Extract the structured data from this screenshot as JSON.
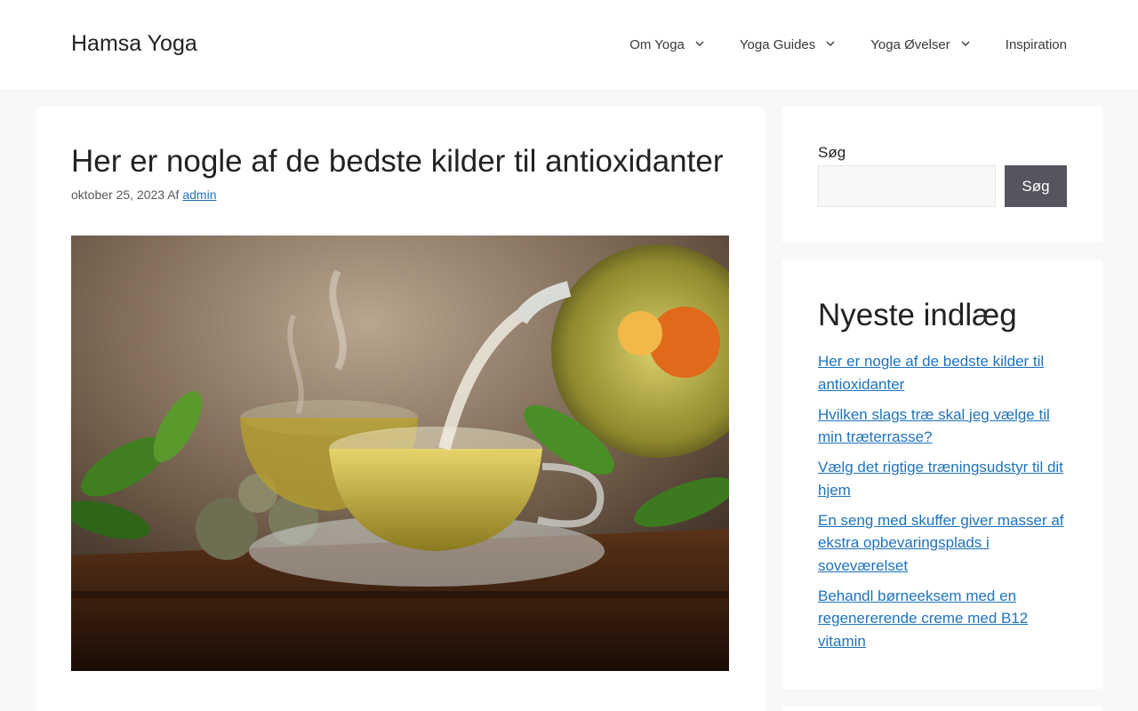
{
  "header": {
    "site_title": "Hamsa Yoga",
    "nav": [
      {
        "label": "Om Yoga",
        "has_dropdown": true
      },
      {
        "label": "Yoga Guides",
        "has_dropdown": true
      },
      {
        "label": "Yoga Øvelser",
        "has_dropdown": true
      },
      {
        "label": "Inspiration",
        "has_dropdown": false
      }
    ]
  },
  "article": {
    "title": "Her er nogle af de bedste kilder til antioxidanter",
    "date": "oktober 25, 2023",
    "by_label": "Af",
    "author": "admin",
    "featured_image_icon": "tea-pot-pouring-image"
  },
  "sidebar": {
    "search": {
      "label": "Søg",
      "value": "",
      "button_label": "Søg"
    },
    "recent": {
      "title": "Nyeste indlæg",
      "items": [
        "Her er nogle af de bedste kilder til antioxidanter",
        "Hvilken slags træ skal jeg vælge til min træterrasse?",
        "Vælg det rigtige træningsudstyr til dit hjem",
        "En seng med skuffer giver masser af ekstra opbevaringsplads i soveværelset",
        "Behandl børneeksem med en regenererende creme med B12 vitamin"
      ]
    }
  },
  "colors": {
    "link": "#1e73be",
    "background": "#f7f8f9",
    "button": "#55555e"
  }
}
